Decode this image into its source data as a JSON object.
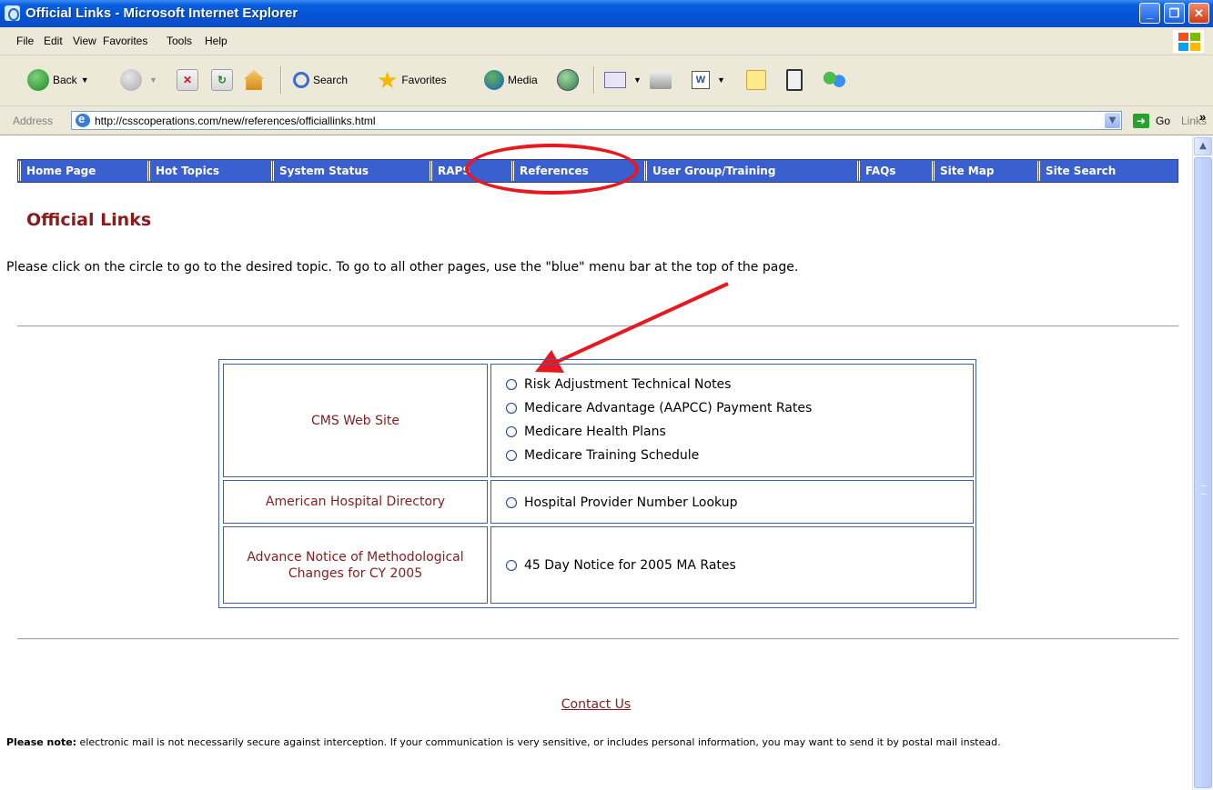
{
  "window": {
    "title": "Official Links - Microsoft Internet Explorer",
    "controls": [
      "_",
      "❐",
      "✕"
    ]
  },
  "menu": [
    "File",
    "Edit",
    "View",
    "Favorites",
    "Tools",
    "Help"
  ],
  "toolbar": {
    "back": "Back",
    "search": "Search",
    "favorites": "Favorites",
    "media": "Media"
  },
  "address": {
    "label": "Address",
    "url": "http://csscoperations.com/new/references/officiallinks.html",
    "go": "Go",
    "links": "Links",
    "links_chevron": "»"
  },
  "nav": {
    "items": [
      "Home Page",
      "Hot Topics",
      "System Status",
      "RAPS",
      "References",
      "User Group/Training",
      "FAQs",
      "Site Map",
      "Site Search"
    ]
  },
  "page": {
    "title": "Official Links",
    "instructions": "Please click on the circle to go to the desired topic. To go to all other pages, use the \"blue\" menu bar at the top of the page."
  },
  "table": {
    "rows": [
      {
        "label": "CMS Web Site",
        "options": [
          "Risk Adjustment Technical Notes",
          "Medicare Advantage (AAPCC) Payment Rates",
          "Medicare Health Plans",
          "Medicare Training Schedule"
        ]
      },
      {
        "label": "American Hospital Directory",
        "options": [
          "Hospital Provider Number Lookup"
        ]
      },
      {
        "label": "Advance Notice of Methodological Changes for CY 2005",
        "options": [
          "45 Day Notice for 2005 MA Rates"
        ]
      }
    ]
  },
  "footer": {
    "contact": "Contact Us",
    "note_bold": "Please note:",
    "note_text": " electronic mail is not necessarily secure against interception. If your communication is very sensitive, or includes personal information, you may want to send it by postal mail instead."
  },
  "colors": {
    "nav_bar": "#3a5fce",
    "title_red": "#8b1a1a",
    "annotation_red": "#e8181e",
    "xp_title_blue": "#0554d8"
  },
  "icons": [
    "ie-icon",
    "back-icon",
    "forward-icon",
    "stop-icon",
    "refresh-icon",
    "home-icon",
    "search-icon",
    "favorites-star-icon",
    "media-icon",
    "history-icon",
    "mail-icon",
    "print-icon",
    "word-icon",
    "notes-icon",
    "messenger-icon",
    "go-arrow-icon",
    "windows-logo-icon"
  ]
}
